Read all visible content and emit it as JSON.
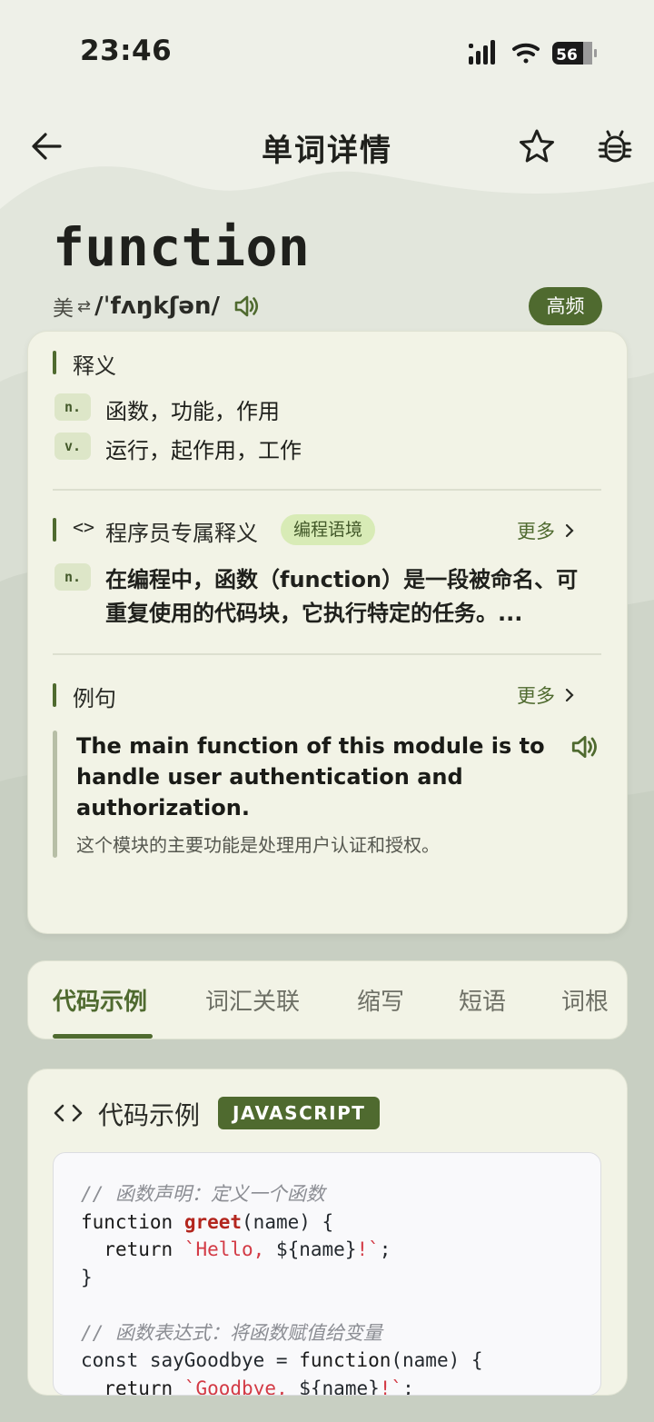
{
  "status_bar": {
    "time": "23:46",
    "battery": "56"
  },
  "header": {
    "title": "单词详情"
  },
  "word": {
    "text": "function",
    "region": "美",
    "swap_glyph": "⇄",
    "ipa": "/ˈfʌŋkʃən/",
    "badge": "高频"
  },
  "definitions": {
    "title": "释义",
    "items": [
      {
        "pos": "n.",
        "text": "函数，功能，作用"
      },
      {
        "pos": "v.",
        "text": "运行，起作用，工作"
      }
    ]
  },
  "programmer": {
    "icon": "<>",
    "title": "程序员专属释义",
    "chip": "编程语境",
    "more": "更多",
    "pos": "n.",
    "text": "在编程中，函数（function）是一段被命名、可重复使用的代码块，它执行特定的任务。..."
  },
  "examples": {
    "title": "例句",
    "more": "更多",
    "en": "The main function of this module is to handle user authentication and authorization.",
    "zh": "这个模块的主要功能是处理用户认证和授权。"
  },
  "tabs": [
    "代码示例",
    "词汇关联",
    "缩写",
    "短语",
    "词根"
  ],
  "code_section": {
    "icon": "<>",
    "title": "代码示例",
    "language": "JAVASCRIPT",
    "lines": [
      {
        "comment": "// 函数声明：定义一个函数"
      },
      {
        "kw": "function",
        "fn": "greet",
        "rest": "(name) {"
      },
      {
        "indent": "  ",
        "kw": "return",
        "str": "`Hello, ",
        "tpl": "${name}",
        "str2": "!`",
        "end": ";"
      },
      {
        "plain": "}"
      },
      {
        "plain": ""
      },
      {
        "comment": "// 函数表达式：将函数赋值给变量"
      },
      {
        "plain": "const sayGoodbye = ",
        "kw": "function",
        "rest": "(name) {"
      },
      {
        "indent": "  ",
        "kw": "return",
        "str": "`Goodbye, ",
        "tpl": "${name}",
        "str2": "!`",
        "end": ";"
      }
    ]
  },
  "colors": {
    "accent": "#4f6a2f",
    "chip_bg": "#d8ebb6",
    "background": "#eef0e8"
  }
}
